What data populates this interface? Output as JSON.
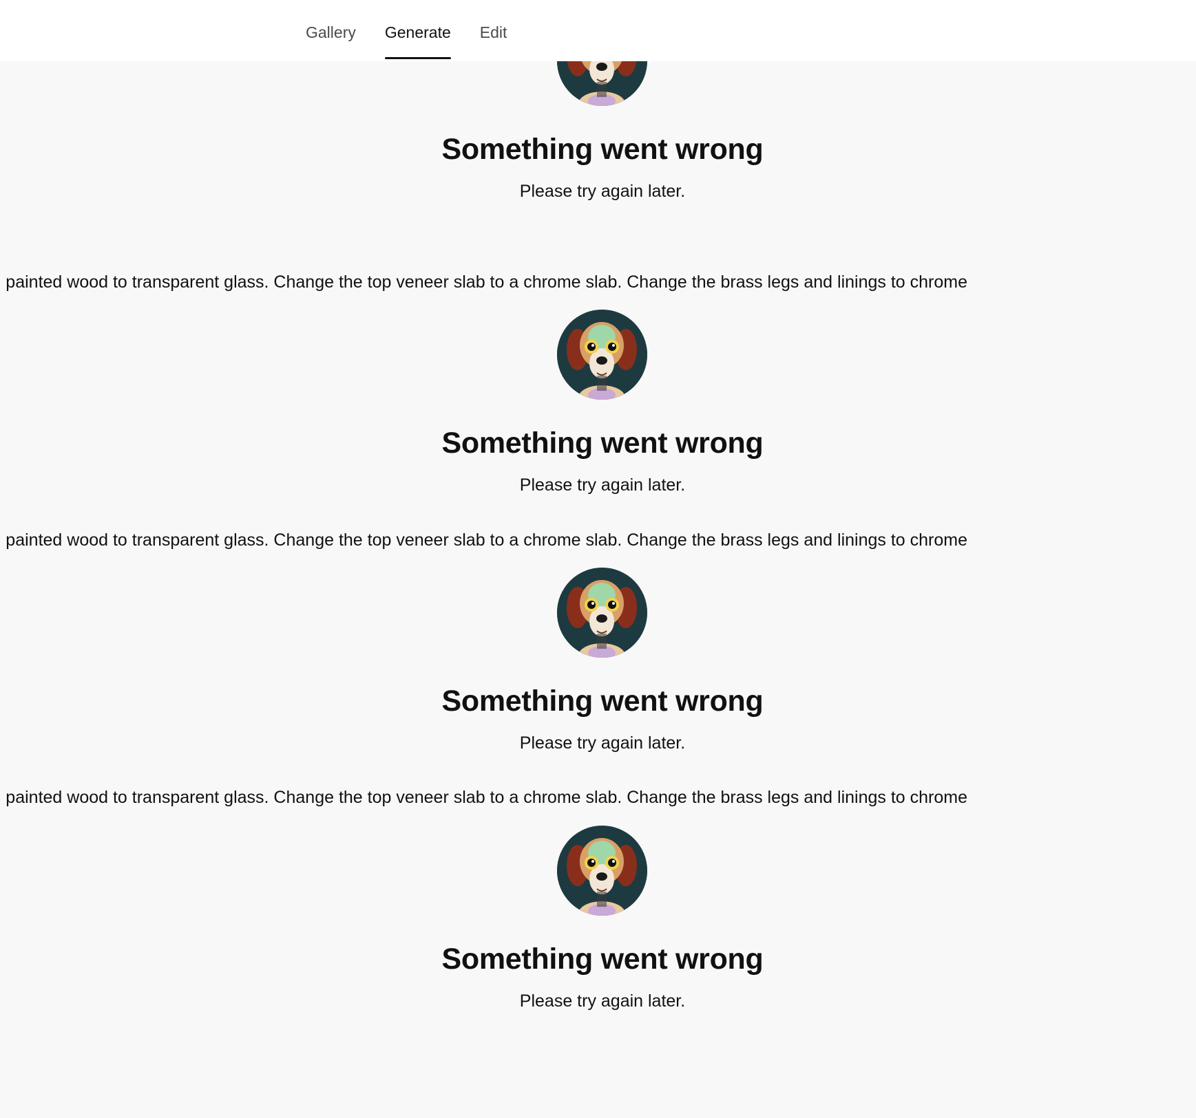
{
  "nav": {
    "tabs": [
      {
        "label": "Gallery",
        "active": false
      },
      {
        "label": "Generate",
        "active": true
      },
      {
        "label": "Edit",
        "active": false
      }
    ]
  },
  "errors": [
    {
      "title": "Something went wrong",
      "message": "Please try again later."
    },
    {
      "title": "Something went wrong",
      "message": "Please try again later."
    },
    {
      "title": "Something went wrong",
      "message": "Please try again later."
    },
    {
      "title": "Something went wrong",
      "message": "Please try again later."
    }
  ],
  "prompts": [
    "painted wood to transparent glass. Change the top veneer slab to a chrome slab. Change the brass legs and linings to chrome",
    "painted wood to transparent glass. Change the top veneer slab to a chrome slab. Change the brass legs and linings to chrome",
    "painted wood to transparent glass. Change the top veneer slab to a chrome slab. Change the brass legs and linings to chrome"
  ],
  "colors": {
    "background": "#f8f8f8",
    "header": "#ffffff",
    "avatar_bg": "#1d3a40"
  },
  "icons": {
    "avatar": "dog-avatar-icon"
  }
}
